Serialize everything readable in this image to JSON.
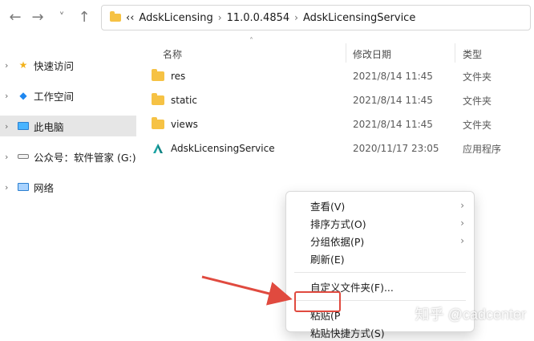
{
  "breadcrumb": {
    "overflow": "‹‹",
    "items": [
      "AdskLicensing",
      "11.0.0.4854",
      "AdskLicensingService"
    ],
    "separator": "›"
  },
  "nav": {
    "back_icon": "←",
    "forward_icon": "→",
    "recent_icon": "˅",
    "up_icon": "↑"
  },
  "sidebar": {
    "items": [
      {
        "label": "快速访问",
        "icon": "star-icon"
      },
      {
        "label": "工作空间",
        "icon": "cloud-icon"
      },
      {
        "label": "此电脑",
        "icon": "pc-icon",
        "selected": true
      },
      {
        "label": "公众号：软件管家 (G:)",
        "icon": "drive-icon"
      },
      {
        "label": "网络",
        "icon": "network-icon"
      }
    ]
  },
  "file_list": {
    "columns": {
      "name": "名称",
      "date": "修改日期",
      "type": "类型"
    },
    "rows": [
      {
        "name": "res",
        "date": "2021/8/14 11:45",
        "type": "文件夹",
        "icon": "folder-icon"
      },
      {
        "name": "static",
        "date": "2021/8/14 11:45",
        "type": "文件夹",
        "icon": "folder-icon"
      },
      {
        "name": "views",
        "date": "2021/8/14 11:45",
        "type": "文件夹",
        "icon": "folder-icon"
      },
      {
        "name": "AdskLicensingService",
        "date": "2020/11/17 23:05",
        "type": "应用程序",
        "icon": "autodesk-app-icon"
      }
    ]
  },
  "context_menu": {
    "items": [
      {
        "label": "查看(V)",
        "submenu": true
      },
      {
        "label": "排序方式(O)",
        "submenu": true
      },
      {
        "label": "分组依据(P)",
        "submenu": true
      },
      {
        "label": "刷新(E)",
        "submenu": false
      },
      {
        "label": "自定义文件夹(F)...",
        "submenu": false
      },
      {
        "label": "粘贴(P",
        "submenu": false,
        "highlighted": true
      },
      {
        "label": "粘贴快捷方式(S)",
        "submenu": false
      }
    ],
    "submenu_icon": "›"
  },
  "watermark": "知乎 @cadcenter",
  "colors": {
    "folder": "#f6c244",
    "selection": "#e6e6e6",
    "annotation_red": "#e04a3f"
  }
}
